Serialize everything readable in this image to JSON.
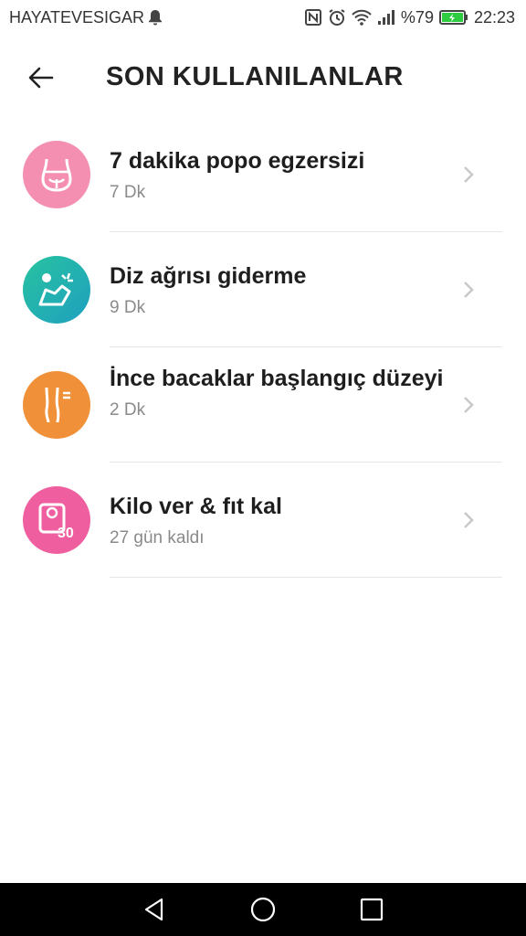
{
  "status": {
    "carrier": "HAYATEVESIGAR",
    "battery": "%79",
    "time": "22:23"
  },
  "header": {
    "title": "SON KULLANILANLAR"
  },
  "items": [
    {
      "title": "7 dakika popo egzersizi",
      "subtitle": "7 Dk",
      "icon": "glutes-icon",
      "color": "#f48fb1"
    },
    {
      "title": "Diz ağrısı giderme",
      "subtitle": "9 Dk",
      "icon": "knee-pain-icon",
      "color": "#26b4a8"
    },
    {
      "title": "İnce bacaklar başlangıç düzeyi",
      "subtitle": "2 Dk",
      "icon": "legs-icon",
      "color": "#f0913a"
    },
    {
      "title": "Kilo ver & fıt kal",
      "subtitle": "27 gün kaldı",
      "icon": "scale-30-icon",
      "color": "#ef5f9f"
    }
  ]
}
